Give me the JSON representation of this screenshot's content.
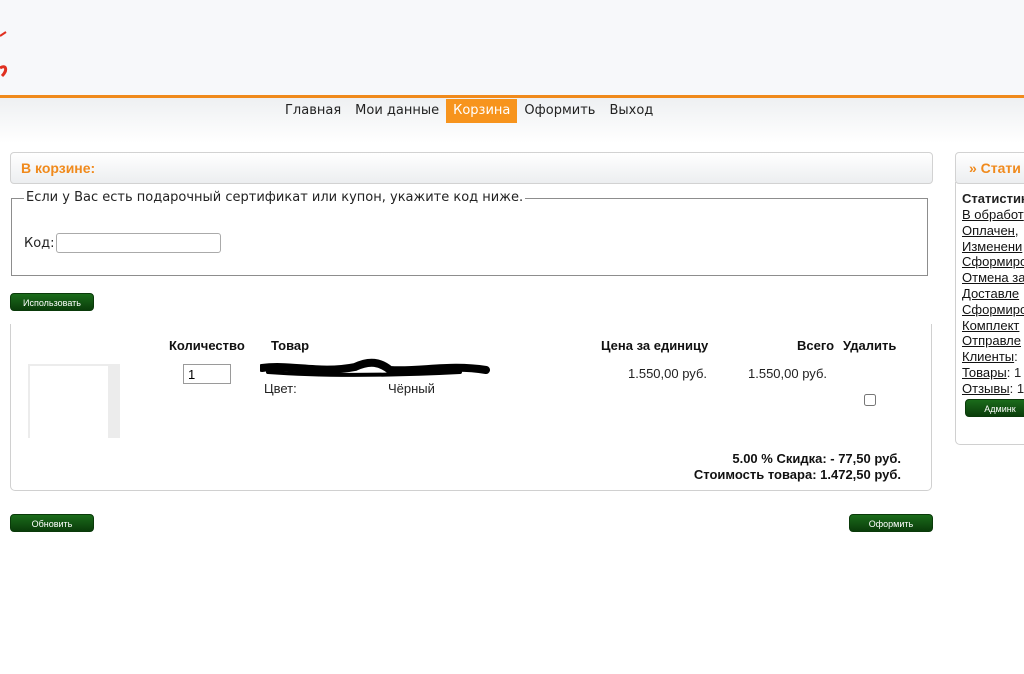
{
  "nav": {
    "items": [
      {
        "label": "Главная"
      },
      {
        "label": "Мои данные"
      },
      {
        "label": "Корзина"
      },
      {
        "label": "Оформить"
      },
      {
        "label": "Выход"
      }
    ]
  },
  "cart": {
    "heading": "В корзине:",
    "coupon": {
      "legend": "Если у Вас есть подарочный сертификат или купон, укажите код ниже.",
      "code_label": "Код:",
      "code_value": "",
      "apply_label": "Использовать"
    },
    "columns": {
      "qty": "Количество",
      "product": "Товар",
      "unit_price": "Цена за единицу",
      "total": "Всего",
      "remove": "Удалить"
    },
    "items": [
      {
        "qty": "1",
        "attr_label": "Цвет:",
        "attr_value": "Чёрный",
        "unit_price": "1.550,00 руб.",
        "total": "1.550,00 руб."
      }
    ],
    "discount_line": "5.00 % Скидка: - 77,50 руб.",
    "subtotal_line": "Стоимость товара: 1.472,50 руб.",
    "update_label": "Обновить",
    "checkout_label": "Оформить"
  },
  "sidebar": {
    "heading": "» Стати",
    "stats_title": "Статистика",
    "links": [
      {
        "label": "В обработ"
      },
      {
        "label": "Оплачен,"
      },
      {
        "label": "Изменени"
      },
      {
        "label": "Сформиро"
      },
      {
        "label": "Отмена за"
      },
      {
        "label": "Доставле"
      },
      {
        "label": "Сформиро"
      },
      {
        "label": "Комплект"
      },
      {
        "label": "Отправле"
      },
      {
        "label": "Клиенты",
        "suffix": ":"
      },
      {
        "label": "Товары",
        "suffix": ": 1"
      },
      {
        "label": "Отзывы",
        "suffix": ": 1"
      }
    ],
    "admin_label": "Админк"
  },
  "colors": {
    "accent": "#f7941d",
    "button_green": "#0f4f0f"
  }
}
